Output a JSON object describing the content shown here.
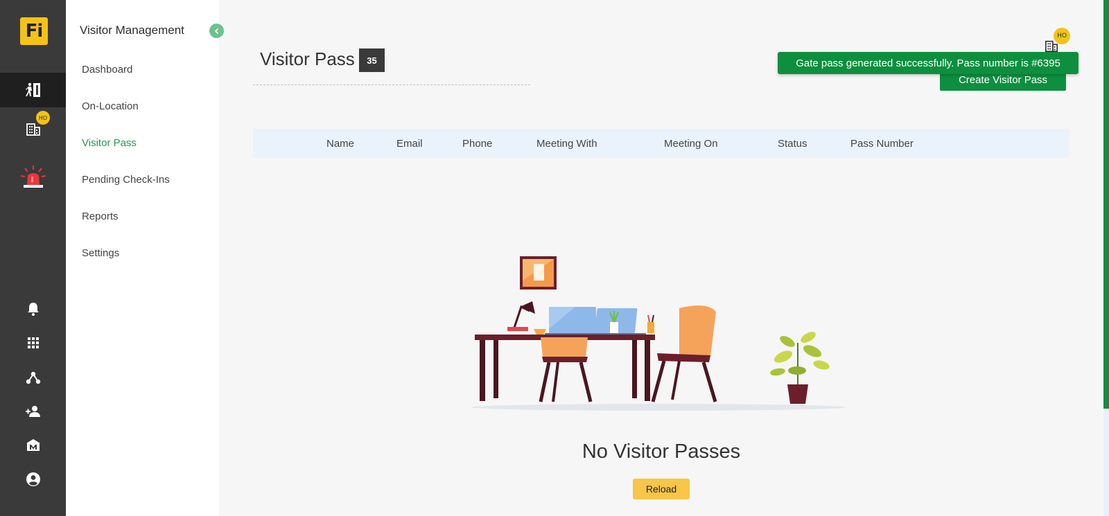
{
  "brand": {
    "logo_text": "Fi"
  },
  "rail": {
    "ho_badge": "HO",
    "icons": [
      "visitor-exit-icon",
      "building-icon",
      "alarm-siren-icon",
      "bell-icon",
      "apps-grid-icon",
      "network-icon",
      "add-person-icon",
      "museum-icon",
      "account-circle-icon"
    ]
  },
  "sidebar": {
    "title": "Visitor Management",
    "items": [
      {
        "label": "Dashboard"
      },
      {
        "label": "On-Location"
      },
      {
        "label": "Visitor Pass"
      },
      {
        "label": "Pending Check-Ins"
      },
      {
        "label": "Reports"
      },
      {
        "label": "Settings"
      }
    ],
    "active_index": 2
  },
  "header": {
    "title": "Visitor Pass",
    "count": "35",
    "create_button": "Create Visitor Pass",
    "ho_badge": "HO"
  },
  "toast": {
    "message": "Gate pass generated successfully. Pass number is #6395"
  },
  "table": {
    "columns": [
      "Name",
      "Email",
      "Phone",
      "Meeting With",
      "Meeting On",
      "Status",
      "Pass Number"
    ]
  },
  "empty_state": {
    "title": "No Visitor Passes",
    "reload_label": "Reload"
  },
  "colors": {
    "rail_bg": "#3a3a3a",
    "brand_yellow": "#f3c316",
    "accent_green": "#0d8f3f",
    "active_nav": "#1f9a52",
    "reload_yellow": "#f7c548"
  }
}
